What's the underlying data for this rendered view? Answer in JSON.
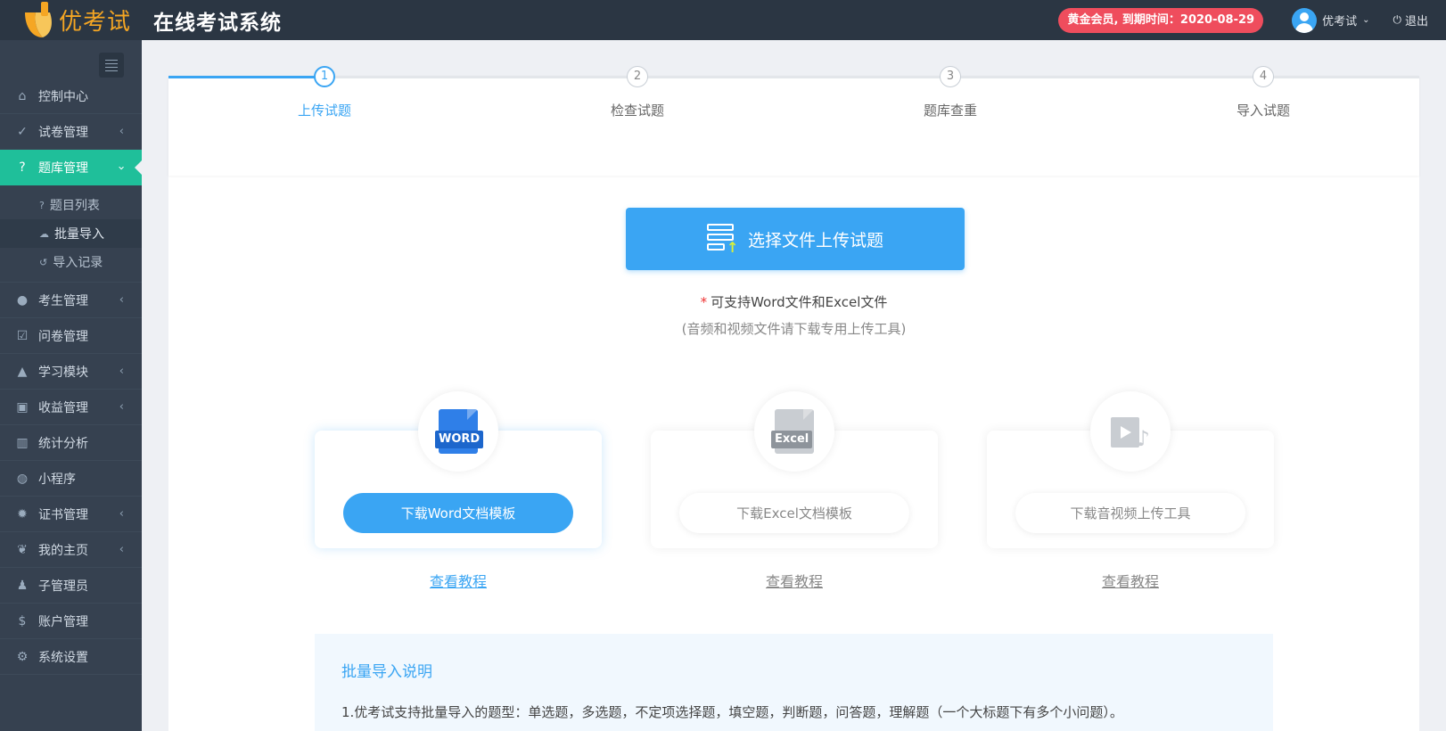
{
  "header": {
    "logo_text": "优考试",
    "app_title": "在线考试系统",
    "member_badge": "黄金会员, 到期时间：2020-08-29",
    "user_name": "优考试",
    "logout_label": "退出"
  },
  "sidebar": {
    "items": [
      {
        "label": "控制中心",
        "icon": "home-icon"
      },
      {
        "label": "试卷管理",
        "icon": "check-circle-icon"
      },
      {
        "label": "题库管理",
        "icon": "question-circle-icon",
        "sub": [
          {
            "label": "题目列表",
            "icon": "question-circle-icon"
          },
          {
            "label": "批量导入",
            "icon": "cloud-upload-icon"
          },
          {
            "label": "导入记录",
            "icon": "history-icon"
          }
        ]
      },
      {
        "label": "考生管理",
        "icon": "user-icon"
      },
      {
        "label": "问卷管理",
        "icon": "checkbox-icon"
      },
      {
        "label": "学习模块",
        "icon": "graduation-cap-icon"
      },
      {
        "label": "收益管理",
        "icon": "money-icon"
      },
      {
        "label": "统计分析",
        "icon": "bar-chart-icon"
      },
      {
        "label": "小程序",
        "icon": "wechat-icon"
      },
      {
        "label": "证书管理",
        "icon": "certificate-icon"
      },
      {
        "label": "我的主页",
        "icon": "leaf-icon"
      },
      {
        "label": "子管理员",
        "icon": "admin-icon"
      },
      {
        "label": "账户管理",
        "icon": "dollar-icon"
      },
      {
        "label": "系统设置",
        "icon": "gear-icon"
      }
    ]
  },
  "steps": [
    {
      "num": "1",
      "label": "上传试题"
    },
    {
      "num": "2",
      "label": "检查试题"
    },
    {
      "num": "3",
      "label": "题库查重"
    },
    {
      "num": "4",
      "label": "导入试题"
    }
  ],
  "upload": {
    "button_label": "选择文件上传试题",
    "star": "*",
    "support_note": "可支持Word文件和Excel文件",
    "support_sub": "(音频和视频文件请下载专用上传工具)"
  },
  "templates": [
    {
      "icon_tag": "WORD",
      "button_label": "下载Word文档模板",
      "link": "查看教程"
    },
    {
      "icon_tag": "Excel",
      "button_label": "下载Excel文档模板",
      "link": "查看教程"
    },
    {
      "icon_tag": "",
      "button_label": "下载音视频上传工具",
      "link": "查看教程"
    }
  ],
  "guide": {
    "title": "批量导入说明",
    "line1": "1.优考试支持批量导入的题型：单选题，多选题，不定项选择题，填空题，判断题，问答题，理解题（一个大标题下有多个小问题）。"
  },
  "colors": {
    "header_bg": "#2b3643",
    "sidebar_bg": "#364150",
    "active_menu": "#1fbf9a",
    "accent_blue": "#3aa5f3",
    "badge_red": "#ef4d5d",
    "logo_orange": "#f5a623"
  }
}
